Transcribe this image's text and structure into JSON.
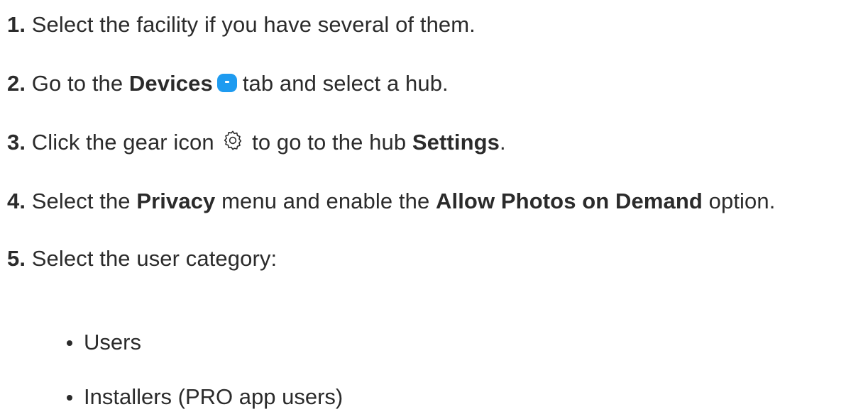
{
  "steps": [
    {
      "num": "1.",
      "text": "Select the facility if you have several of them."
    },
    {
      "num": "2.",
      "pre": "Go to the ",
      "bold": "Devices",
      "post": "tab and select a hub."
    },
    {
      "num": "3.",
      "pre": "Click the gear icon ",
      "mid": " to go to the hub ",
      "bold": "Settings",
      "post": "."
    },
    {
      "num": "4.",
      "pre": "Select the ",
      "bold1": "Privacy",
      "mid": " menu and enable the ",
      "bold2": "Allow Photos on Demand",
      "post": " option."
    },
    {
      "num": "5.",
      "text": "Select the user category:"
    }
  ],
  "categories": [
    "Users",
    "Installers (PRO app users)"
  ],
  "icons": {
    "devices_tab": "devices-tab-icon",
    "gear": "gear-icon",
    "accent_color": "#1e9bf0"
  }
}
